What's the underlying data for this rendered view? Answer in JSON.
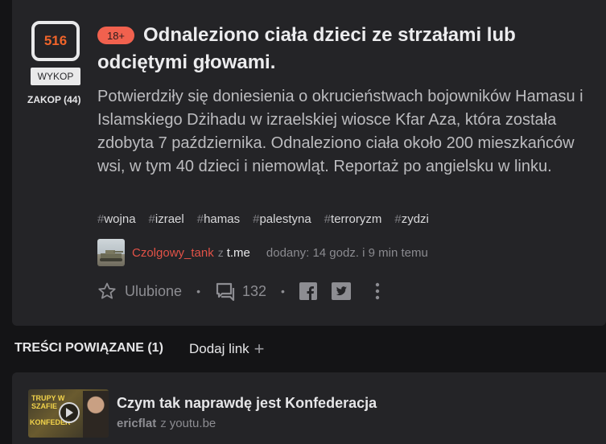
{
  "vote": {
    "count": "516",
    "wykop_label": "WYKOP",
    "zakop_label": "ZAKOP (44)"
  },
  "post": {
    "age_badge": "18+",
    "title_line1": "Odnaleziono ciała dzieci ze strzałami lub",
    "title_line2": "odciętymi głowami.",
    "description": "Potwierdziły się doniesienia o okrucieństwach bojowników Hamasu i Islamskiego Dżihadu w izraelskiej wiosce Kfar Aza, która została zdobyta 7 października. Odnaleziono ciała około 200 mieszkańców wsi, w tym 40 dzieci i niemowląt. Reportaż po angielsku w linku.",
    "tags": [
      "wojna",
      "izrael",
      "hamas",
      "palestyna",
      "terroryzm",
      "zydzi"
    ],
    "author": "Czolgowy_tank",
    "from_word": "z",
    "source": "t.me",
    "added": "dodany: 14 godz. i 9 min temu"
  },
  "actions": {
    "favorite_label": "Ulubione",
    "comments_count": "132",
    "facebook_icon": "facebook-icon",
    "twitter_icon": "twitter-icon"
  },
  "related": {
    "header": "TREŚCI POWIĄZANE (1)",
    "add_link_label": "Dodaj link",
    "items": [
      {
        "title": "Czym tak naprawdę jest Konfederacja",
        "author": "ericflat",
        "from_word": "z",
        "source": "youtu.be",
        "thumb_text1": "TRUPY W SZAFIE",
        "thumb_text2": "KONFEDER"
      }
    ]
  },
  "colors": {
    "accent": "#f0642a",
    "author": "#e25247",
    "badge": "#f1614e",
    "background": "#141416",
    "card": "#242427"
  }
}
